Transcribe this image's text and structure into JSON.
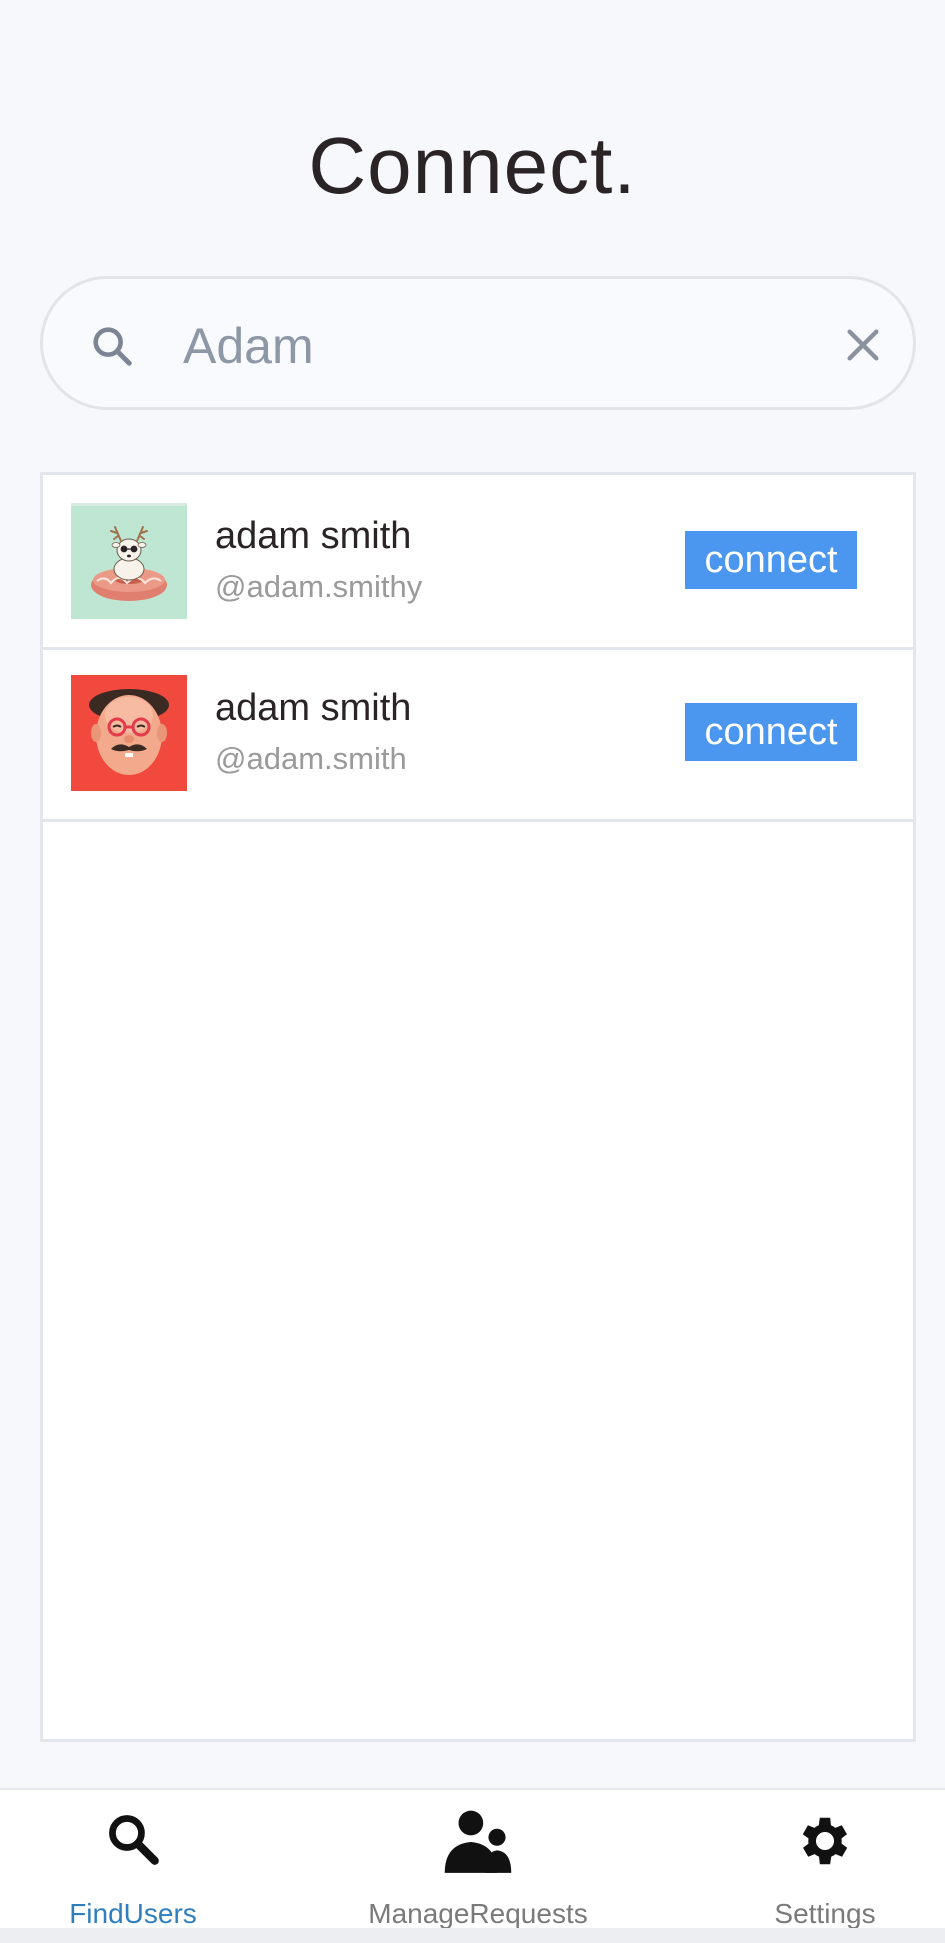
{
  "header": {
    "title": "Connect."
  },
  "search": {
    "value": "Adam",
    "placeholder": "",
    "search_icon": "search-icon",
    "clear_icon": "close-icon"
  },
  "results": [
    {
      "name": "adam smith",
      "handle": "@adam.smithy",
      "button_label": "connect",
      "avatar": "deer-on-donut-avatar"
    },
    {
      "name": "adam smith",
      "handle": "@adam.smith",
      "button_label": "connect",
      "avatar": "bald-man-mustache-avatar"
    }
  ],
  "tabs": [
    {
      "label": "FindUsers",
      "icon": "search-icon",
      "active": true
    },
    {
      "label": "ManageRequests",
      "icon": "users-icon",
      "active": false
    },
    {
      "label": "Settings",
      "icon": "gear-icon",
      "active": false
    }
  ],
  "colors": {
    "accent": "#4b96ef",
    "active_tab": "#2f7fbf",
    "background": "#f7f8fc"
  }
}
